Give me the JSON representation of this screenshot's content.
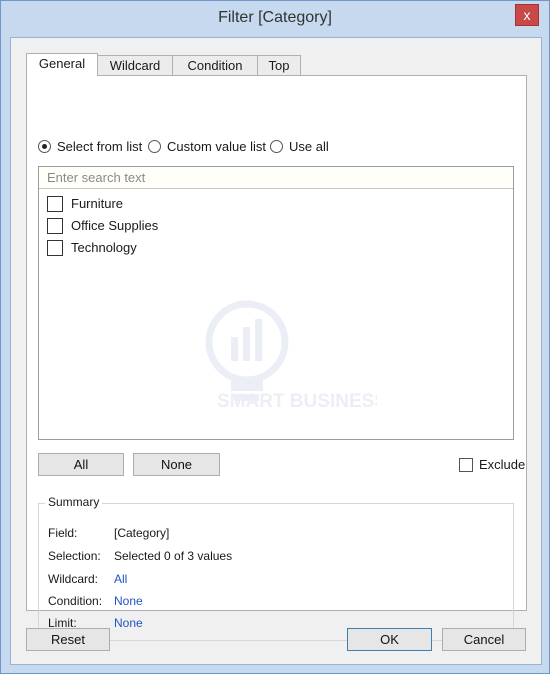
{
  "window": {
    "title": "Filter [Category]",
    "close_label": "x"
  },
  "tabs": [
    {
      "label": "General",
      "active": true
    },
    {
      "label": "Wildcard",
      "active": false
    },
    {
      "label": "Condition",
      "active": false
    },
    {
      "label": "Top",
      "active": false
    }
  ],
  "radios": [
    {
      "label": "Select from list",
      "checked": true
    },
    {
      "label": "Custom value list",
      "checked": false
    },
    {
      "label": "Use all",
      "checked": false
    }
  ],
  "search": {
    "placeholder": "Enter search text",
    "value": ""
  },
  "list_items": [
    {
      "label": "Furniture",
      "checked": false
    },
    {
      "label": "Office Supplies",
      "checked": false
    },
    {
      "label": "Technology",
      "checked": false
    }
  ],
  "watermark": {
    "text": "SMART BUSINESS"
  },
  "buttons": {
    "all": "All",
    "none": "None",
    "reset": "Reset",
    "ok": "OK",
    "cancel": "Cancel"
  },
  "exclude": {
    "label": "Exclude",
    "checked": false
  },
  "summary": {
    "legend": "Summary",
    "field_label": "Field:",
    "field_value": "[Category]",
    "selection_label": "Selection:",
    "selection_value": "Selected 0 of 3 values",
    "wildcard_label": "Wildcard:",
    "wildcard_value": "All",
    "condition_label": "Condition:",
    "condition_value": "None",
    "limit_label": "Limit:",
    "limit_value": "None"
  },
  "colors": {
    "link": "#1f54c7",
    "frame": "#c6d9ef",
    "close": "#c94848"
  }
}
